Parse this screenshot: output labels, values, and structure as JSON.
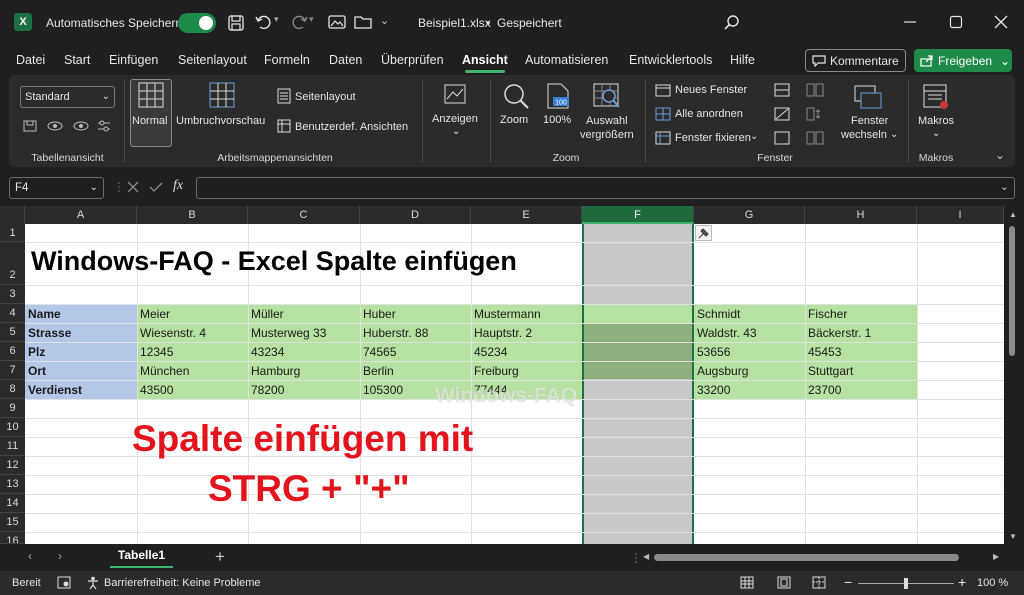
{
  "titlebar": {
    "autosave_label": "Automatisches Speichern",
    "filename": "Beispiel1.xlsx",
    "separator": "•",
    "save_state": "Gespeichert"
  },
  "menu": [
    "Datei",
    "Start",
    "Einfügen",
    "Seitenlayout",
    "Formeln",
    "Daten",
    "Überprüfen",
    "Ansicht",
    "Automatisieren",
    "Entwicklertools",
    "Hilfe"
  ],
  "menu_active": "Ansicht",
  "buttons": {
    "comments": "Kommentare",
    "share": "Freigeben"
  },
  "ribbon": {
    "view_dropdown": "Standard",
    "group_sheet_view": "Tabellenansicht",
    "normal": "Normal",
    "page_break": "Umbruchvorschau",
    "page_layout": "Seitenlayout",
    "custom_views": "Benutzerdef. Ansichten",
    "group_workbook_views": "Arbeitsmappenansichten",
    "show": "Anzeigen",
    "zoom": "Zoom",
    "zoom100": "100%",
    "zoom_sel_1": "Auswahl",
    "zoom_sel_2": "vergrößern",
    "group_zoom": "Zoom",
    "new_window": "Neues Fenster",
    "arrange_all": "Alle anordnen",
    "freeze": "Fenster fixieren",
    "switch_1": "Fenster",
    "switch_2": "wechseln",
    "group_window": "Fenster",
    "macros": "Makros",
    "group_macros": "Makros"
  },
  "formula_bar": {
    "name_box": "F4",
    "fx": "fx",
    "formula": ""
  },
  "sheet": {
    "columns": [
      "A",
      "B",
      "C",
      "D",
      "E",
      "F",
      "G",
      "H",
      "I"
    ],
    "selected_column": "F",
    "rows": [
      "1",
      "2",
      "3",
      "4",
      "5",
      "6",
      "7",
      "8",
      "9",
      "10",
      "11",
      "12",
      "13",
      "14",
      "15",
      "16"
    ],
    "title": "Windows-FAQ - Excel Spalte einfügen",
    "labels": [
      "Name",
      "Strasse",
      "Plz",
      "Ort",
      "Verdienst"
    ],
    "records": [
      [
        "Meier",
        "Wiesenstr. 4",
        "12345",
        "München",
        "43500"
      ],
      [
        "Müller",
        "Musterweg 33",
        "43234",
        "Hamburg",
        "78200"
      ],
      [
        "Huber",
        "Huberstr. 88",
        "74565",
        "Berlin",
        "105300"
      ],
      [
        "Mustermann",
        "Hauptstr. 2",
        "45234",
        "Freiburg",
        "77444"
      ],
      [
        "Schmidt",
        "Waldstr. 43",
        "53656",
        "Augsburg",
        "33200"
      ],
      [
        "Fischer",
        "Bäckerstr. 1",
        "45453",
        "Stuttgart",
        "23700"
      ]
    ],
    "overlay_line1": "Spalte einfügen mit",
    "overlay_line2": "STRG + \"+\"",
    "watermark": "Windows-FAQ"
  },
  "tabs": {
    "sheet_name": "Tabelle1",
    "add": "+"
  },
  "status": {
    "ready": "Bereit",
    "accessibility": "Barrierefreiheit: Keine Probleme",
    "zoom_minus": "−",
    "zoom_plus": "+",
    "zoom_level": "100 %"
  },
  "colors": {
    "accent": "#1e8a4a",
    "green_fill": "#b7e1a1",
    "blue_fill": "#b4c7e7",
    "red_text": "#e3141b"
  }
}
